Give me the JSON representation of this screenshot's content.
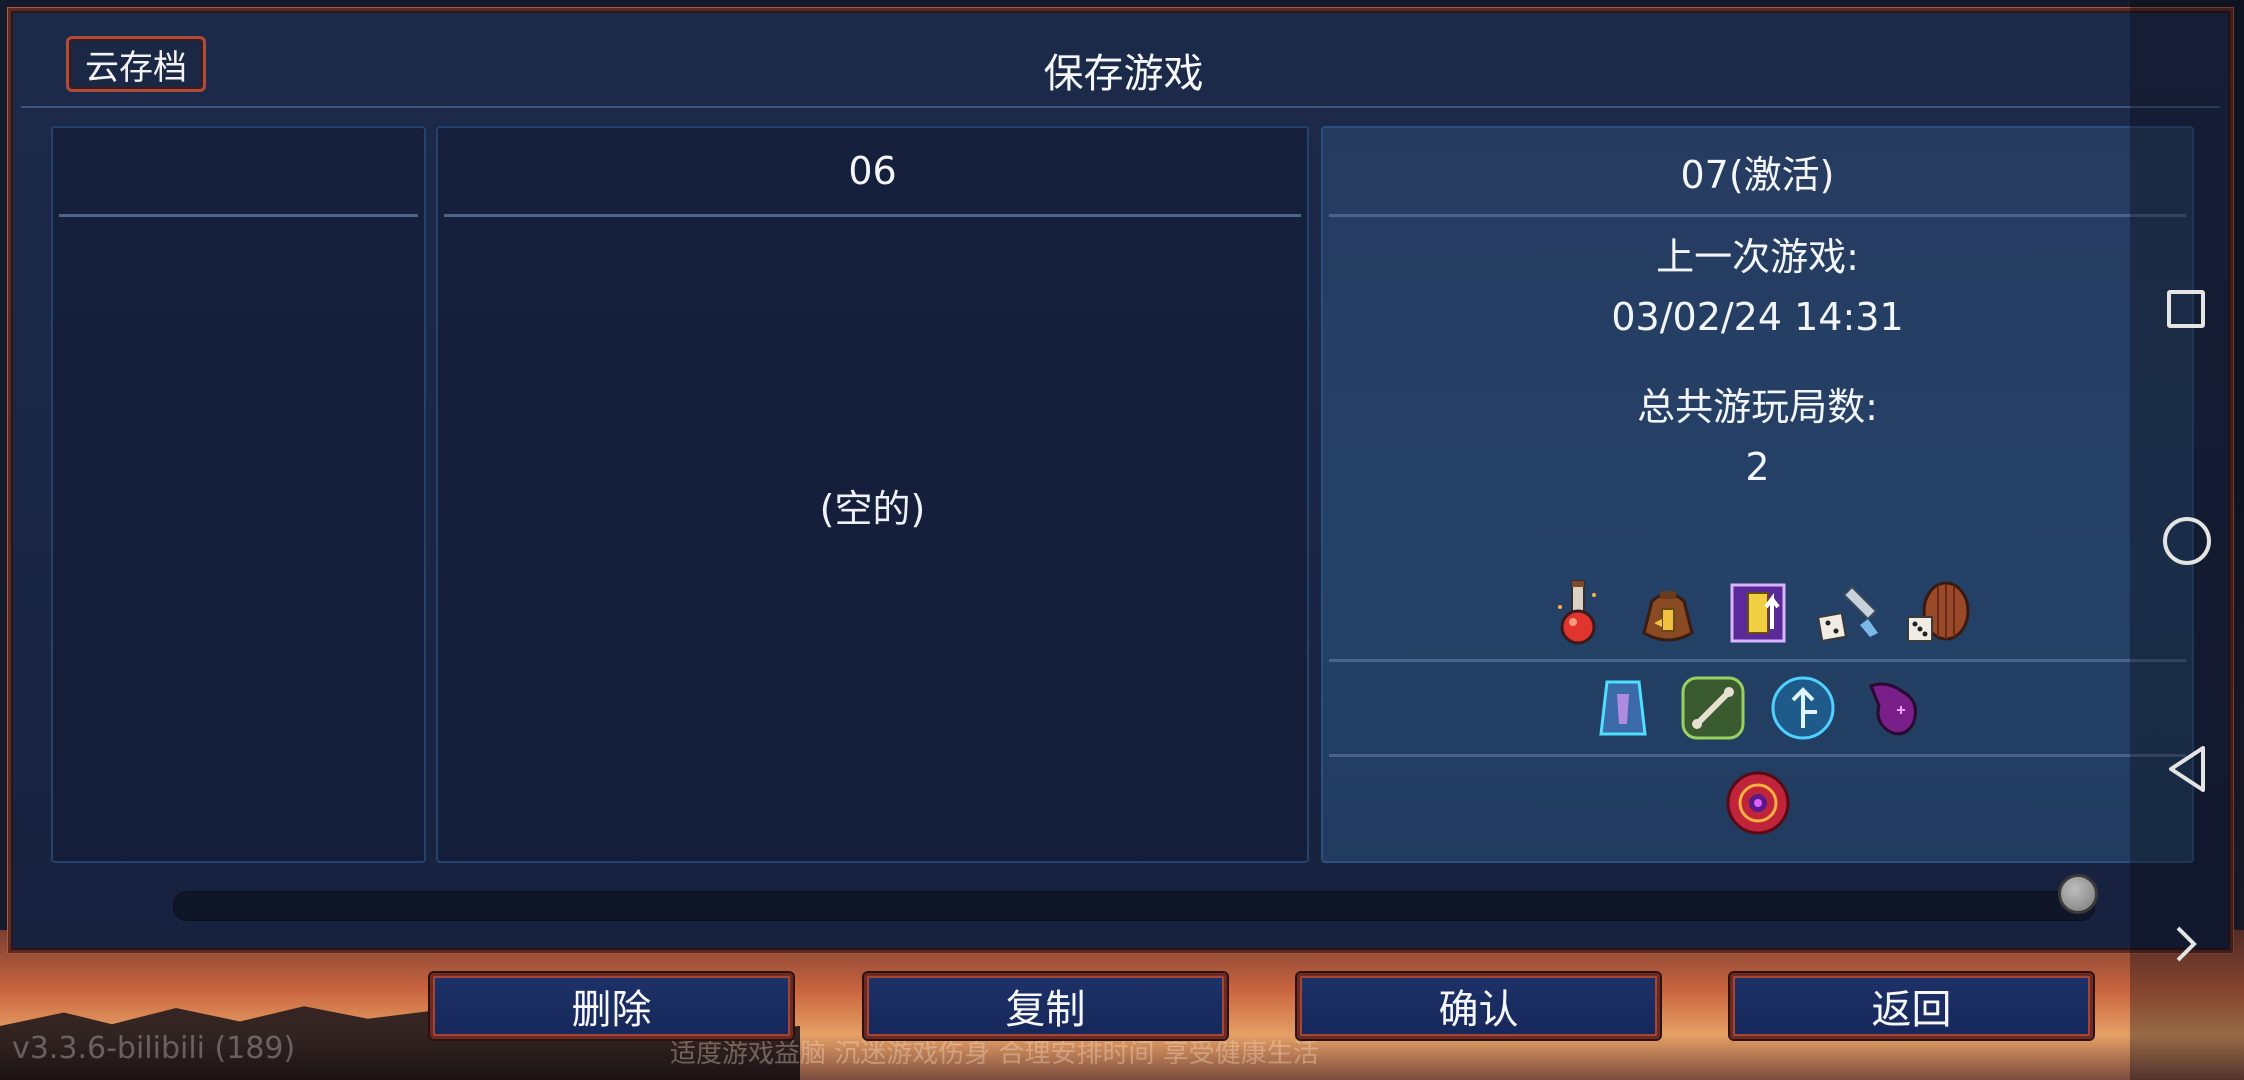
{
  "window": {
    "title": "保存游戏"
  },
  "header": {
    "cloud_save_label": "云存档"
  },
  "slots": [
    {
      "label": "",
      "state": "partial"
    },
    {
      "label": "06",
      "empty_label": "(空的)"
    },
    {
      "label": "07(激活)",
      "last_played_label": "上一次游戏:",
      "last_played_value": "03/02/24 14:31",
      "total_runs_label": "总共游玩局数:",
      "total_runs_value": "2",
      "item_row_1": [
        "potion-flask-icon",
        "gold-bag-icon",
        "upgrade-scroll-icon",
        "dice-axe-icon",
        "dice-shield-icon"
      ],
      "item_row_2": [
        "tactics-rune-icon",
        "bone-rune-icon",
        "arrow-rune-icon",
        "cursed-heart-icon"
      ],
      "item_row_3": [
        "boss-cell-icon"
      ]
    }
  ],
  "scroll": {
    "position": 1.0
  },
  "buttons": {
    "delete": "删除",
    "copy": "复制",
    "confirm": "确认",
    "back": "返回"
  },
  "footer": {
    "version": "v3.3.6-bilibili (189)",
    "hint": "适度游戏益脑  沉迷游戏伤身  合理安排时间  享受健康生活"
  },
  "colors": {
    "panel_bg": "#1a2645",
    "accent_border": "#b24a3a",
    "button_bg": "#1d3268"
  }
}
